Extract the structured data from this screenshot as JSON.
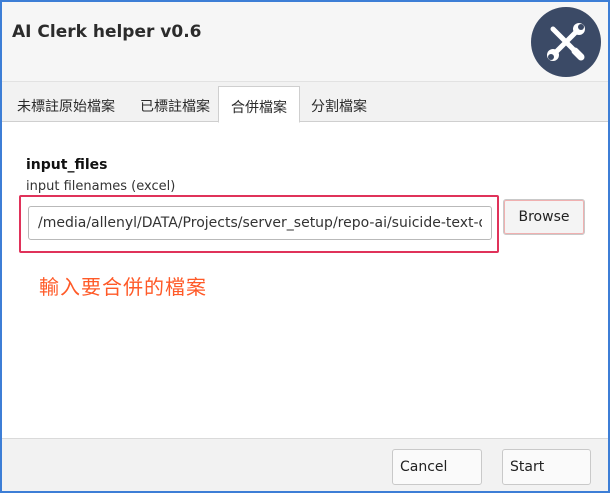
{
  "app": {
    "title": "AI Clerk helper v0.6",
    "logo_icon": "wrench-screwdriver-icon"
  },
  "tabs": [
    {
      "label": "未標註原始檔案",
      "active": false
    },
    {
      "label": "已標註檔案",
      "active": false
    },
    {
      "label": "合併檔案",
      "active": true
    },
    {
      "label": "分割檔案",
      "active": false
    }
  ],
  "form": {
    "field_name": "input_files",
    "field_description": "input filenames (excel)",
    "input_value": "/media/allenyl/DATA/Projects/server_setup/repo-ai/suicide-text-de",
    "browse_label": "Browse"
  },
  "annotation": {
    "text": "輸入要合併的檔案",
    "color": "#ff5a28"
  },
  "footer": {
    "cancel_label": "Cancel",
    "start_label": "Start"
  },
  "colors": {
    "highlight": "#e0325a",
    "window_border": "#3d7ed6",
    "logo_bg": "#3b4a66"
  }
}
